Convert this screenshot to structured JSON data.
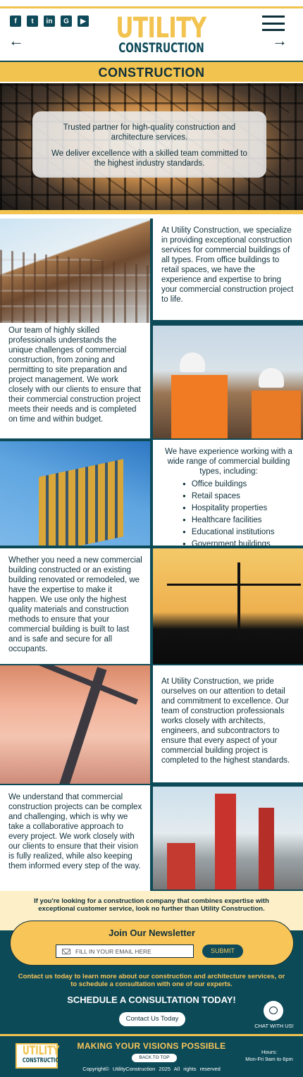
{
  "header": {
    "social_icons": [
      "facebook-icon",
      "twitter-icon",
      "linkedin-icon",
      "google-icon",
      "youtube-icon"
    ],
    "logo_line1": "UTILITY",
    "logo_line2": "CONSTRUCTION"
  },
  "page_title": "CONSTRUCTION",
  "hero": {
    "line1": "Trusted partner for high-quality construction and architecture services.",
    "line2": "We deliver excellence with a skilled team committed to the highest industry standards."
  },
  "sections": {
    "s1": "At Utility Construction, we specialize in providing exceptional construction services for commercial buildings of all types. From office buildings to retail spaces, we have the experience and expertise to bring your commercial construction project to life.",
    "s2": "Our team of highly skilled professionals understands the unique challenges of commercial construction, from zoning and permitting to site preparation and project management. We work closely with our clients to ensure that their commercial construction project meets their needs and is completed on time and within budget.",
    "s3_intro": "We have experience working with a wide range of commercial building types, including:",
    "s3_list": [
      "Office buildings",
      "Retail spaces",
      "Hospitality properties",
      "Healthcare facilities",
      "Educational institutions",
      "Government buildings"
    ],
    "s4": "Whether you need a new commercial building constructed or an existing building renovated or remodeled, we have the expertise to make it happen. We use only the highest quality materials and construction methods to ensure that your commercial building is built to last and is safe and secure for all occupants.",
    "s5": "At Utility Construction, we pride ourselves on our attention to detail and commitment to excellence. Our team of construction professionals works closely with architects, engineers, and subcontractors to ensure that every aspect of your commercial building project is completed to the highest standards.",
    "s6": "We understand that commercial construction projects can be complex and challenging, which is why we take a collaborative approach to every project. We work closely with our clients to ensure that their vision is fully realized, while also keeping them informed every step of the way."
  },
  "cta": {
    "cream_text": "If you're looking for a construction company that combines expertise with exceptional customer service, look no further than Utility Construction.",
    "newsletter_title": "Join Our Newsletter",
    "email_placeholder": "FILL IN YOUR EMAIL HERE",
    "submit_label": "SUBMIT",
    "contact_text": "Contact us today to learn more about our construction and architecture services, or to schedule a consultation with one of our experts.",
    "schedule_title": "SCHEDULE A CONSULTATION TODAY!",
    "contact_button": "Contact Us Today",
    "chat_label": "CHAT WITH US!"
  },
  "footer": {
    "logo_line1": "UTILITY",
    "logo_line2": "CONSTRUCTION",
    "motto": "MAKING  YOUR VISIONS  POSSIBLE",
    "back_to_top": "BACK TO TOP",
    "hours_label": "Hours:",
    "hours_value": "Mon-Fri 9am to 6pm",
    "copyright": "Copyright©     UtilityConstruction 2025     All rights reserved"
  },
  "colors": {
    "accent": "#f2c34f",
    "primary": "#0d4a58",
    "dark": "#0e2f3a"
  }
}
